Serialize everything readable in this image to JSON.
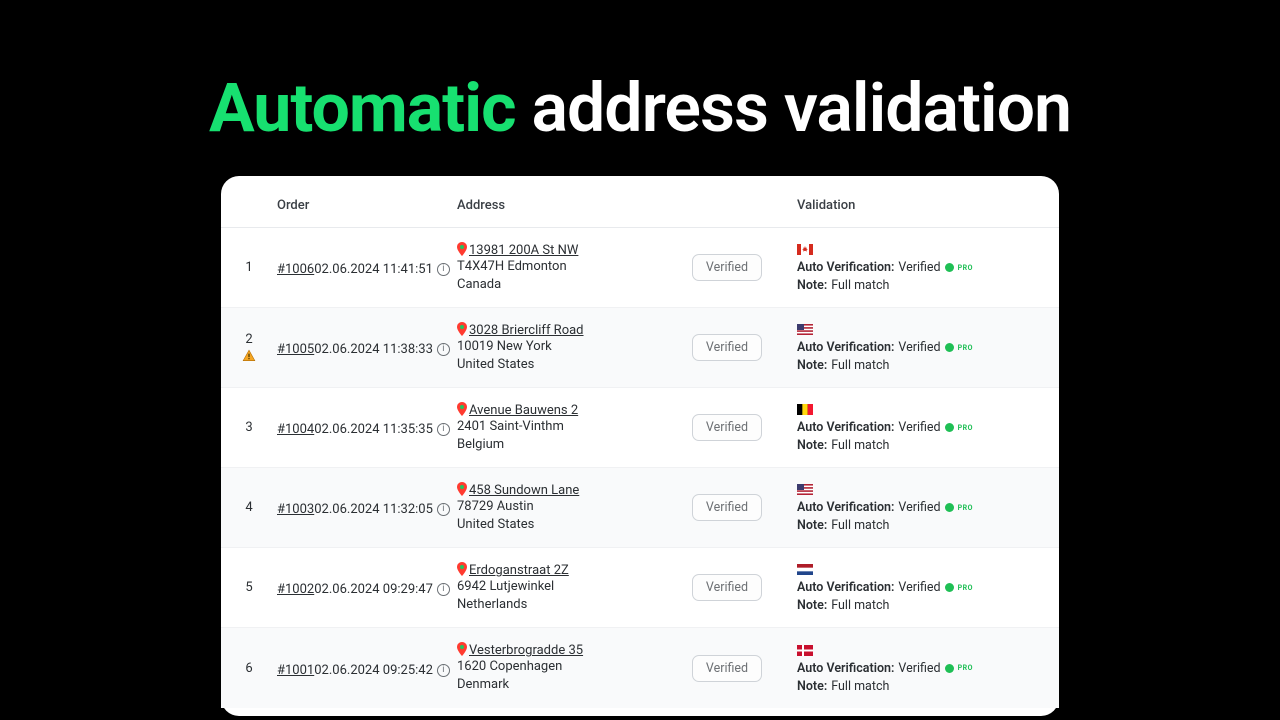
{
  "hero": {
    "accent": "Automatic",
    "rest": " address validation"
  },
  "columns": {
    "order": "Order",
    "address": "Address",
    "validation": "Validation"
  },
  "badge_label": "Verified",
  "auto_verification_label": "Auto Verification:",
  "auto_verification_value": "Verified",
  "note_label": "Note:",
  "pro_label": "PRO",
  "rows": [
    {
      "idx": "1",
      "warning": false,
      "order_id": "#1006",
      "order_date": "02.06.2024 11:41:51",
      "addr_line1": "13981 200A St NW",
      "addr_line2": "T4X47H Edmonton",
      "addr_country": "Canada",
      "flag": "ca",
      "note_value": "Full match"
    },
    {
      "idx": "2",
      "warning": true,
      "order_id": "#1005",
      "order_date": "02.06.2024 11:38:33",
      "addr_line1": "3028 Briercliff Road",
      "addr_line2": "10019 New York",
      "addr_country": "United States",
      "flag": "us",
      "note_value": "Full match"
    },
    {
      "idx": "3",
      "warning": false,
      "order_id": "#1004",
      "order_date": "02.06.2024 11:35:35",
      "addr_line1": "Avenue Bauwens 2",
      "addr_line2": "2401 Saint-Vinthm",
      "addr_country": "Belgium",
      "flag": "be",
      "note_value": "Full match"
    },
    {
      "idx": "4",
      "warning": false,
      "order_id": "#1003",
      "order_date": "02.06.2024 11:32:05",
      "addr_line1": "458 Sundown Lane",
      "addr_line2": "78729 Austin",
      "addr_country": "United States",
      "flag": "us",
      "note_value": "Full match"
    },
    {
      "idx": "5",
      "warning": false,
      "order_id": "#1002",
      "order_date": "02.06.2024 09:29:47",
      "addr_line1": "Erdoganstraat 2Z",
      "addr_line2": "6942 Lutjewinkel",
      "addr_country": "Netherlands",
      "flag": "nl",
      "note_value": "Full match"
    },
    {
      "idx": "6",
      "warning": false,
      "order_id": "#1001",
      "order_date": "02.06.2024 09:25:42",
      "addr_line1": "Vesterbrogradde 35",
      "addr_line2": "1620 Copenhagen",
      "addr_country": "Denmark",
      "flag": "dk",
      "note_value": "Full match"
    }
  ]
}
